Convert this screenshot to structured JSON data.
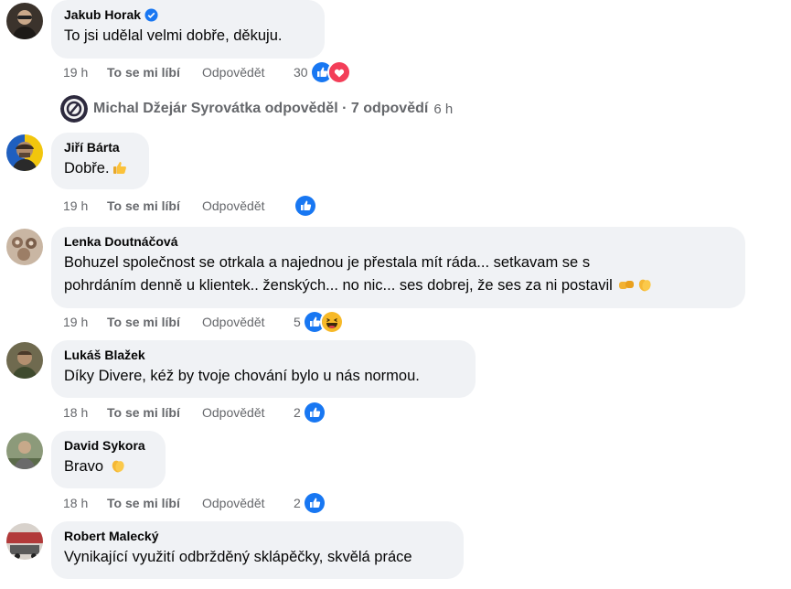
{
  "comments": [
    {
      "author": "Jakub Horak",
      "text": "To jsi udělal velmi dobře, děkuju.",
      "time": "19 h",
      "like": "To se mi líbí",
      "reply": "Odpovědět",
      "count": "30",
      "verified": true
    },
    {
      "author": "Jiří Bárta",
      "text": "Dobře.",
      "time": "19 h",
      "like": "To se mi líbí",
      "reply": "Odpovědět",
      "count": ""
    },
    {
      "author": "Lenka Doutnáčová",
      "text_line1": "Bohuzel společnost se otrkala a najednou je přestala mít ráda... setkavam se s",
      "text_line2": "pohrdáním denně u klientek.. ženských... no nic... ses dobrej, že ses za ni postavil",
      "time": "19 h",
      "like": "To se mi líbí",
      "reply": "Odpovědět",
      "count": "5"
    },
    {
      "author": "Lukáš Blažek",
      "text": "Díky Divere, kéž by tvoje chování bylo u nás normou.",
      "time": "18 h",
      "like": "To se mi líbí",
      "reply": "Odpovědět",
      "count": "2"
    },
    {
      "author": "David Sykora",
      "text": "Bravo",
      "time": "18 h",
      "like": "To se mi líbí",
      "reply": "Odpovědět",
      "count": "2"
    },
    {
      "author": "Robert Malecký",
      "text": "Vynikající využití odbržděný sklápěčky, skvělá práce"
    }
  ],
  "replies_link": {
    "text": "Michal Džejár Syrovátka odpověděl · 7 odpovědí",
    "ago": "6 h"
  },
  "colors": {
    "like_blue": "#1877f2",
    "love_red": "#f33e58",
    "haha_yellow": "#f7b928",
    "bubble_bg": "#f0f2f5",
    "meta_gray": "#65676b"
  }
}
